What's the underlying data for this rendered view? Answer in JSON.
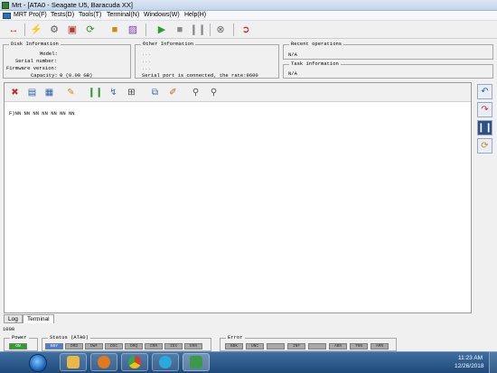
{
  "window": {
    "title": "Mrt - [ATA0 - Seagate U5, Baracuda XX]"
  },
  "menu": {
    "items": [
      "MRT Pro(F)",
      "Tests(D)",
      "Tools(T)",
      "Terminal(N)",
      "Windows(W)",
      "Help(H)"
    ]
  },
  "disk_info": {
    "title": "Disk Information",
    "model_label": "Model:",
    "serial_label": "Serial number:",
    "firmware_label": "Firmware version:",
    "capacity_label": "Capacity:",
    "capacity_value": "0 (0.00 GB)"
  },
  "other_info": {
    "title": "Other Information",
    "line1": "...",
    "line2": "...",
    "line3": "...",
    "serial_status": "Serial port is connected, the rate:9600"
  },
  "recent_ops": {
    "title": "Recent operations",
    "value": "N/A"
  },
  "task_info": {
    "title": "Task information",
    "value": "N/A"
  },
  "editor": {
    "content": "F)NN NN NN NN NN NN NN"
  },
  "tabs": [
    "Log",
    "Terminal"
  ],
  "counter": "1000",
  "power": {
    "title": "Power",
    "led": "ON"
  },
  "status": {
    "title": "Status (ATA0)",
    "leds": [
      "BSY",
      "DRD",
      "DWF",
      "DSC",
      "DRQ",
      "CRR",
      "IDX",
      "ERR"
    ]
  },
  "error": {
    "title": "Error",
    "leds": [
      "BBK",
      "UNC",
      "",
      "INF",
      "",
      "ABR",
      "T0N",
      "AMN"
    ]
  },
  "clock": {
    "time": "11:23 AM",
    "date": "12/26/2018"
  },
  "colors": {
    "led_on": "#2aa22a",
    "led_busy": "#4b7fd1",
    "led_off": "#a9a9a9",
    "taskbar": "#1f4a7a"
  },
  "icons": {
    "toolbar": [
      "connect-icon",
      "power-icon",
      "settings-icon",
      "chip-icon",
      "recover-icon",
      "box-icon",
      "package-icon",
      "play-icon",
      "stop-icon",
      "pause-icon",
      "cancel-icon",
      "exit-icon"
    ],
    "editor": [
      "clear-icon",
      "save-icon",
      "save-as-icon",
      "edit-icon",
      "pause-icon",
      "branch-icon",
      "export-icon",
      "copy-icon",
      "brush-icon",
      "find-icon",
      "find-next-icon"
    ],
    "side": [
      "undo-icon",
      "redo-icon",
      "stop-icon",
      "run-icon"
    ]
  }
}
